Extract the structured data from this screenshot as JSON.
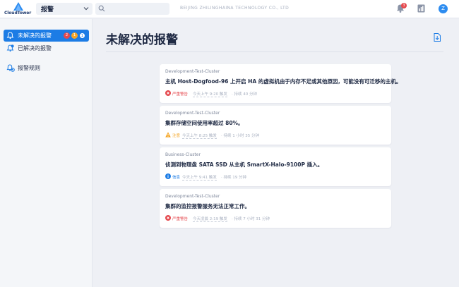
{
  "header": {
    "logo_text": "CloudTower",
    "module": "报警",
    "search": {
      "value": "",
      "placeholder": ""
    },
    "company": "BEIJING ZHILINGHAINA TECHNOLOGY CO., LTD",
    "notification_count": "3",
    "avatar_initial": "Z"
  },
  "sidebar": {
    "items": [
      {
        "label": "未解决的报警",
        "badges": [
          "2",
          "1",
          "1"
        ],
        "active": true,
        "icon": "alert-bell-icon"
      },
      {
        "label": "已解决的报警",
        "active": false,
        "icon": "resolved-bell-icon"
      },
      {
        "label": "报警规则",
        "active": false,
        "icon": "alert-rule-icon"
      }
    ]
  },
  "main": {
    "title": "未解决的报警",
    "alerts": [
      {
        "cluster": "Development-Test-Cluster",
        "message": "主机 Host-Dogfood-96 上开启 HA 的虚拟机由于内存不足或其他原因，可能没有可迁移的主机。",
        "severity": "严重警告",
        "time": "今天上午 9:20 触发",
        "duration": "· 持续 40 分钟",
        "severity_color": "#e5484d"
      },
      {
        "cluster": "Development-Test-Cluster",
        "message": "集群存储空间使用率超过 80%。",
        "severity": "注意",
        "time": "今天上午 8:25 触发",
        "duration": "· 持续 1 小时 35 分钟",
        "severity_color": "#f5a524"
      },
      {
        "cluster": "Business-Cluster",
        "message": "侦测到物理盘 SATA SSD 从主机 SmartX-Halo-9100P 插入。",
        "severity": "信息",
        "time": "今天上午 9:41 触发",
        "duration": "· 持续 19 分钟",
        "severity_color": "#1c7ce5"
      },
      {
        "cluster": "Development-Test-Cluster",
        "message": "集群的监控报警服务无法正常工作。",
        "severity": "严重警告",
        "time": "今天凌晨 2:19 触发",
        "duration": "· 持续 7 小时 31 分钟",
        "severity_color": "#e5484d"
      }
    ]
  }
}
